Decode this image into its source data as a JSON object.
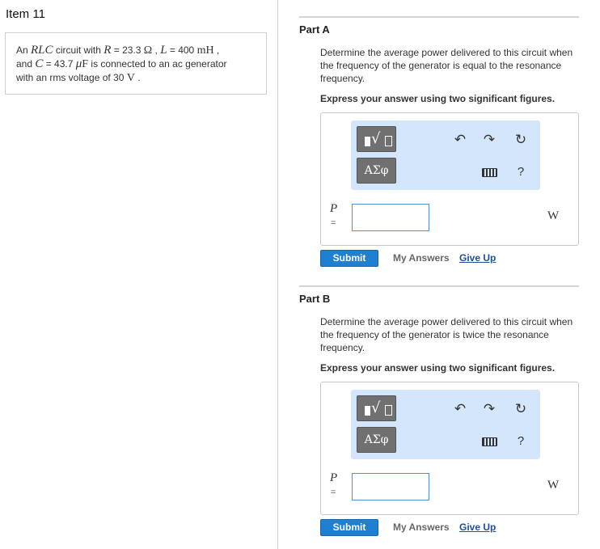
{
  "item": {
    "title": "Item 11"
  },
  "problem": {
    "t1": "An ",
    "rlc": "RLC",
    "t2": " circuit with ",
    "r_sym": "R",
    "t3": " = 23.3 ",
    "ohm": "Ω",
    "t4": " , ",
    "l_sym": "L",
    "t5": " = 400 ",
    "mh": "mH",
    "t6": " ,",
    "t7": "and ",
    "c_sym": "C",
    "t8": " = 43.7 ",
    "mu": "μ",
    "f": "F",
    "t9": " is connected to an ac generator",
    "t10": "with an rms voltage of 30 ",
    "v": "V",
    "t11": " ."
  },
  "parts": [
    {
      "title": "Part A",
      "description": "Determine the average power delivered to this circuit when the frequency of the generator is equal to the resonance frequency.",
      "instruction": "Express your answer using two significant figures.",
      "variable": "P",
      "equals": "=",
      "input_value": "",
      "unit": "W",
      "greek_label": "ΑΣφ",
      "help_label": "?",
      "submit_label": "Submit",
      "my_answers_label": "My Answers",
      "give_up_label": "Give Up"
    },
    {
      "title": "Part B",
      "description": "Determine the average power delivered to this circuit when the frequency of the generator is twice the resonance frequency.",
      "instruction": "Express your answer using two significant figures.",
      "variable": "P",
      "equals": "=",
      "input_value": "",
      "unit": "W",
      "greek_label": "ΑΣφ",
      "help_label": "?",
      "submit_label": "Submit",
      "my_answers_label": "My Answers",
      "give_up_label": "Give Up"
    }
  ],
  "icons": {
    "templates": "templates-icon",
    "undo": "undo-icon",
    "redo": "redo-icon",
    "reset": "reset-icon",
    "keyboard": "keyboard-icon",
    "help": "help-icon"
  },
  "colors": {
    "submit": "#1f7fd1",
    "toolbar": "#d3e6fb",
    "give_up_link": "#1f4f9c"
  }
}
